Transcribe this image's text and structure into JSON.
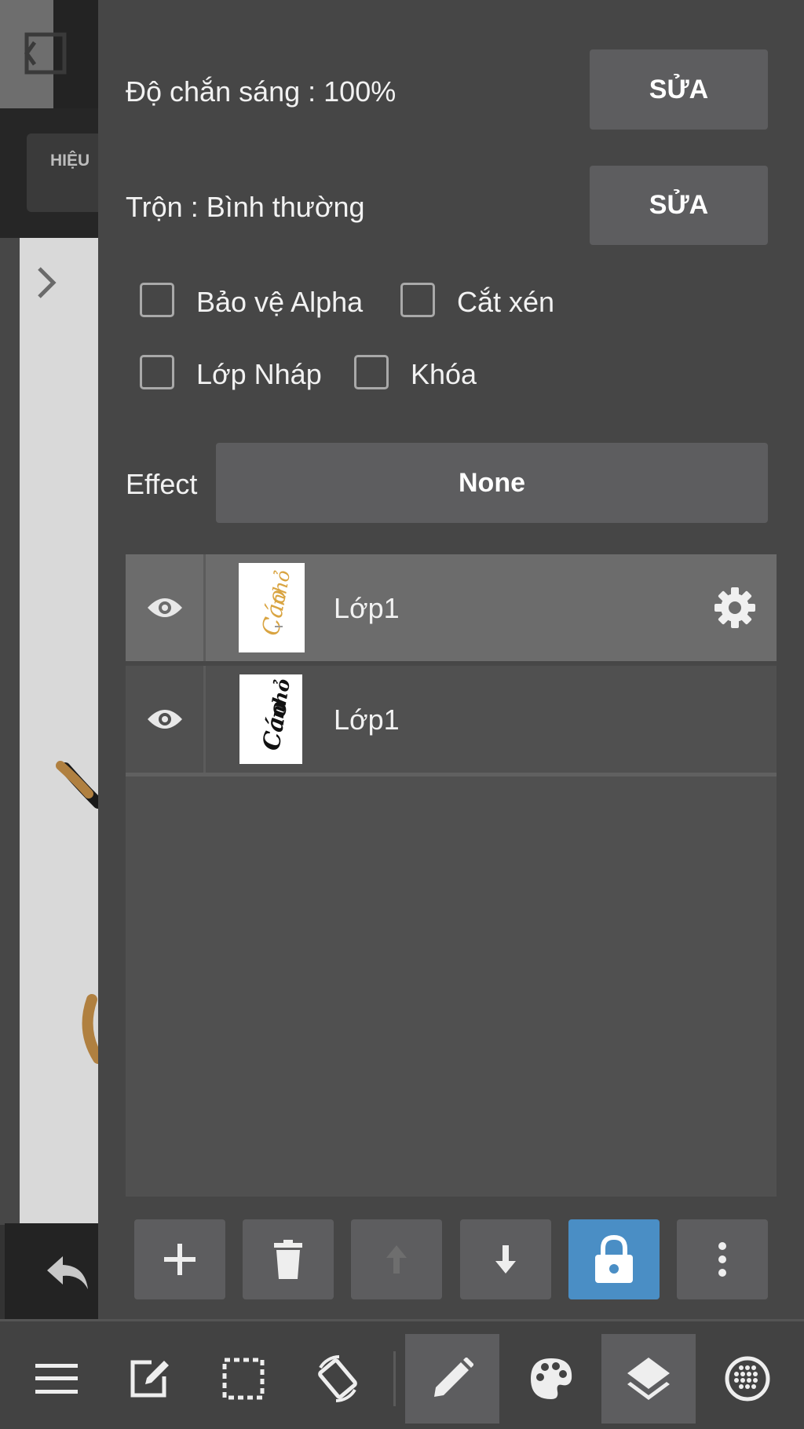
{
  "background": {
    "tab_label": "HIỆU"
  },
  "panel": {
    "opacity_label": "Độ chắn sáng : 100%",
    "opacity_button": "SỬA",
    "blend_label": "Trộn : Bình thường",
    "blend_button": "SỬA",
    "checkboxes": [
      {
        "label": "Bảo vệ Alpha",
        "checked": false
      },
      {
        "label": "Cắt xén",
        "checked": false
      },
      {
        "label": "Lớp Nháp",
        "checked": false
      },
      {
        "label": "Khóa",
        "checked": false
      }
    ],
    "effect_label": "Effect",
    "effect_value": "None"
  },
  "layers": [
    {
      "name": "Lớp1",
      "visible": true,
      "selected": true,
      "thumb_text": "Cáo nhỏ"
    },
    {
      "name": "Lớp1",
      "visible": true,
      "selected": false,
      "thumb_text": "Cáo nhỏ"
    }
  ],
  "layer_actions": [
    {
      "icon": "plus-icon",
      "enabled": true
    },
    {
      "icon": "trash-icon",
      "enabled": true
    },
    {
      "icon": "arrow-up-icon",
      "enabled": false
    },
    {
      "icon": "arrow-down-icon",
      "enabled": true
    },
    {
      "icon": "lock-icon",
      "enabled": true,
      "active": true
    },
    {
      "icon": "more-vertical-icon",
      "enabled": true
    }
  ],
  "toolbar": [
    {
      "icon": "menu-icon",
      "active": false
    },
    {
      "icon": "edit-icon",
      "active": false
    },
    {
      "icon": "selection-icon",
      "active": false
    },
    {
      "icon": "rotate-icon",
      "active": false
    },
    {
      "icon": "pen-icon",
      "active": true
    },
    {
      "icon": "palette-icon",
      "active": false
    },
    {
      "icon": "layers-icon",
      "active": true
    },
    {
      "icon": "material-icon",
      "active": false
    }
  ],
  "colors": {
    "panel_bg": "#464646",
    "button_bg": "#5d5d5f",
    "accent": "#4a8ec5",
    "selected_row": "#6c6c6c"
  }
}
